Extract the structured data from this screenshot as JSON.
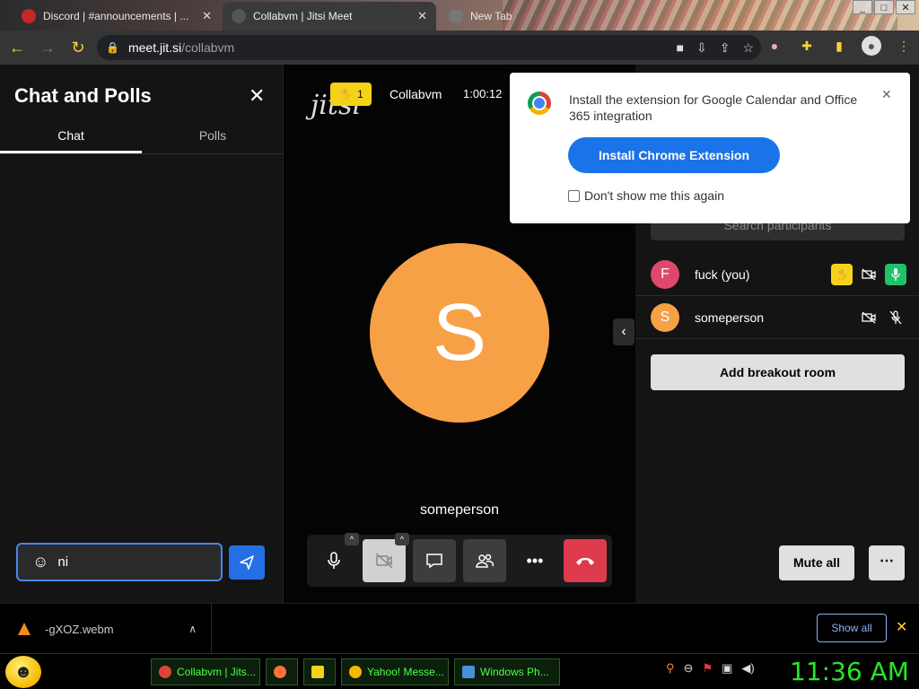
{
  "browser": {
    "tabs": [
      {
        "title": "Discord | #announcements | ...",
        "active": false,
        "fav_color": "#c62828"
      },
      {
        "title": "Collabvm | Jitsi Meet",
        "active": true,
        "fav_color": "#555555"
      },
      {
        "title": "New Tab",
        "active": false,
        "fav_color": "#777777"
      }
    ],
    "url_host": "meet.jit.si",
    "url_path": "/collabvm"
  },
  "chat_panel": {
    "title": "Chat and Polls",
    "tabs": [
      "Chat",
      "Polls"
    ],
    "input_value": "ni"
  },
  "stage": {
    "logo": "jitsi",
    "raised_hands": "1",
    "meeting_name": "Collabvm",
    "duration": "1:00:12",
    "speaker_initial": "S",
    "speaker_name": "someperson",
    "speaker_color": "#f7a147"
  },
  "participants": {
    "search_placeholder": "Search participants",
    "list": [
      {
        "initial": "F",
        "name": "fuck (you)",
        "color": "#e0476d"
      },
      {
        "initial": "S",
        "name": "someperson",
        "color": "#f7a147"
      }
    ],
    "add_breakout": "Add breakout room",
    "mute_all": "Mute all",
    "more": "⋯"
  },
  "popup": {
    "message": "Install the extension for Google Calendar and Office 365 integration",
    "install_label": "Install Chrome Extension",
    "dont_show": "Don't show me this again"
  },
  "downloads": {
    "filename": "-gXOZ.webm",
    "show_all": "Show all"
  },
  "taskbar": {
    "items": [
      {
        "label": "Collabvm | Jits...",
        "icon_color": "#db4437"
      },
      {
        "label": "",
        "icon_color": "#ff7139"
      },
      {
        "label": "",
        "icon_color": "#f5d21a"
      },
      {
        "label": "Yahoo! Messe...",
        "icon_color": "#f5b800"
      },
      {
        "label": "Windows Ph...",
        "icon_color": "#4a90d9"
      }
    ],
    "clock": "11:36 AM"
  }
}
